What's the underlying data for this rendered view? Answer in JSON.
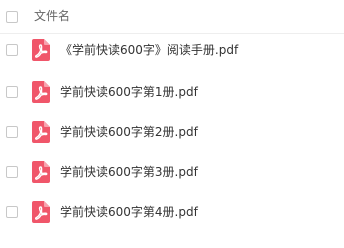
{
  "header": {
    "column_label": "文件名"
  },
  "files": [
    {
      "name": "《学前快读600字》阅读手册.pdf",
      "icon": "pdf-icon"
    },
    {
      "name": "学前快读600字第1册.pdf",
      "icon": "pdf-icon"
    },
    {
      "name": "学前快读600字第2册.pdf",
      "icon": "pdf-icon"
    },
    {
      "name": "学前快读600字第3册.pdf",
      "icon": "pdf-icon"
    },
    {
      "name": "学前快读600字第4册.pdf",
      "icon": "pdf-icon"
    }
  ],
  "colors": {
    "pdf_icon": "#f0566a",
    "text": "#333333",
    "header_text": "#666666"
  }
}
